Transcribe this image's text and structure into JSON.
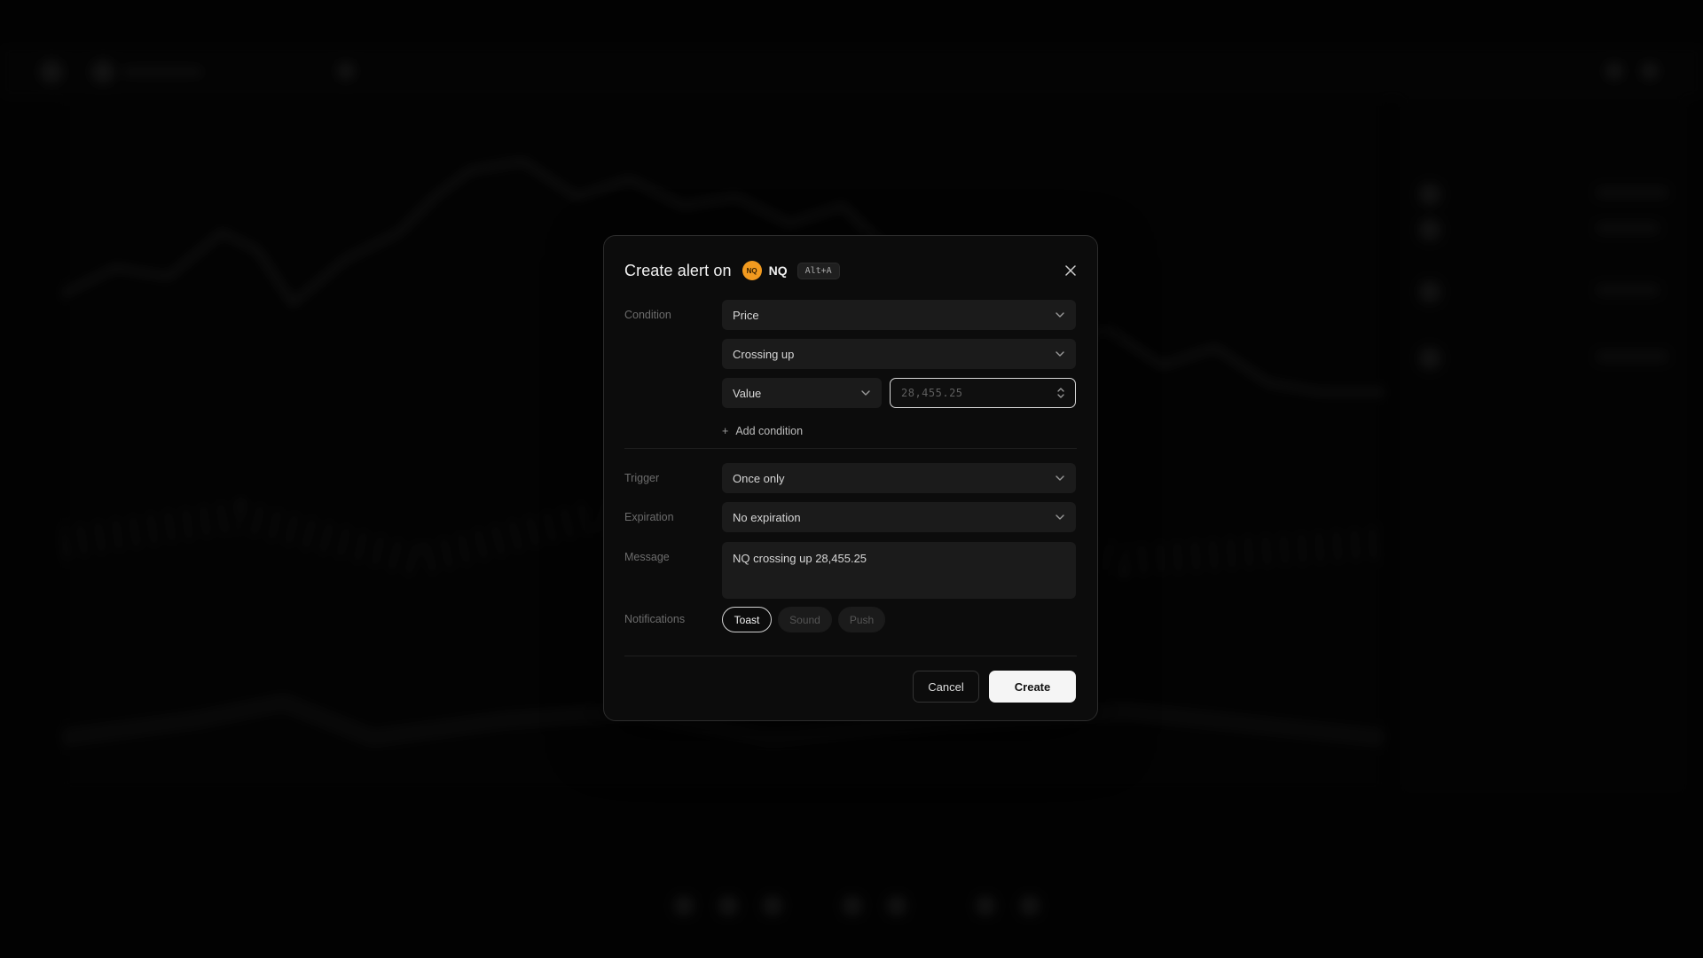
{
  "modal": {
    "title": "Create alert on",
    "symbol_badge": "NQ",
    "symbol": "NQ",
    "shortcut": "Alt+A",
    "close_icon": "close-icon"
  },
  "condition": {
    "label": "Condition",
    "source": "Price",
    "operator": "Crossing up",
    "value_type": "Value",
    "value_placeholder": "28,455.25",
    "add_condition": "Add condition"
  },
  "trigger": {
    "label": "Trigger",
    "value": "Once only"
  },
  "expiration": {
    "label": "Expiration",
    "value": "No expiration"
  },
  "message": {
    "label": "Message",
    "value": "NQ crossing up 28,455.25"
  },
  "notifications": {
    "label": "Notifications",
    "options": [
      {
        "label": "Toast",
        "selected": true
      },
      {
        "label": "Sound",
        "selected": false
      },
      {
        "label": "Push",
        "selected": false
      }
    ]
  },
  "actions": {
    "cancel": "Cancel",
    "create": "Create"
  },
  "colors": {
    "symbol_badge": "#f29a1f",
    "modal_bg": "#0c0c0c",
    "primary_button": "#f5f5f5"
  }
}
